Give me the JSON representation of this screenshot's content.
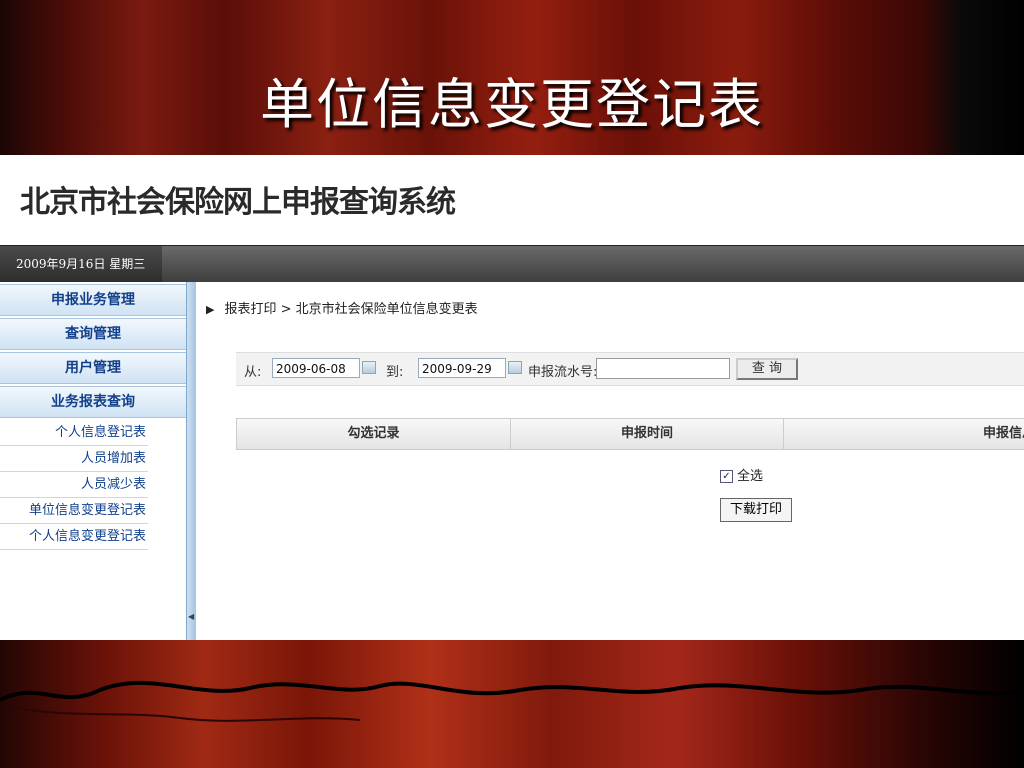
{
  "slide": {
    "title": "单位信息变更登记表"
  },
  "app": {
    "system_title": "北京市社会保险网上申报查询系统",
    "date": "2009年9月16日 星期三"
  },
  "sidebar": {
    "menus": [
      "申报业务管理",
      "查询管理",
      "用户管理",
      "业务报表查询"
    ],
    "sub_items": [
      "个人信息登记表",
      "人员增加表",
      "人员减少表",
      "单位信息变更登记表",
      "个人信息变更登记表"
    ]
  },
  "breadcrumb": {
    "root": "报表打印",
    "separator": ">",
    "current": "北京市社会保险单位信息变更表"
  },
  "filter": {
    "from_label": "从:",
    "from_value": "2009-06-08",
    "to_label": "到:",
    "to_value": "2009-09-29",
    "serial_label": "申报流水号:",
    "serial_value": "",
    "query_button": "查 询"
  },
  "table": {
    "columns": [
      "勾选记录",
      "申报时间",
      "申报信息"
    ]
  },
  "select_all": {
    "label": "全选",
    "checked": true
  },
  "print_button": "下载打印",
  "colors": {
    "menu_text": "#12408a",
    "topbar": "#3e3e3e",
    "curtain": "#8a2012"
  }
}
